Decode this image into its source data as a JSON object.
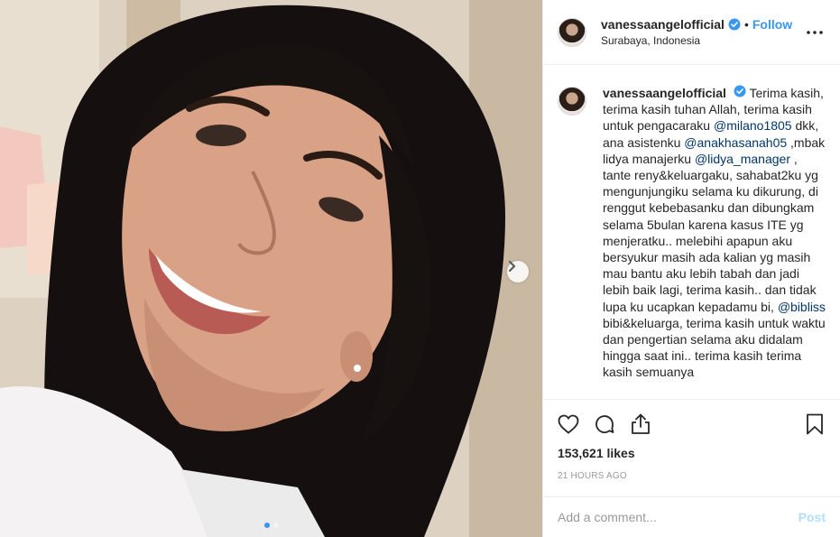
{
  "post": {
    "photo_alt": "",
    "carousel_count": 2,
    "carousel_active": 0
  },
  "header": {
    "username": "vanessaangelofficial",
    "separator": "•",
    "follow_label": "Follow",
    "location": "Surabaya, Indonesia",
    "more_icon": "more-horizontal-icon"
  },
  "caption": {
    "username": "vanessaangelofficial",
    "parts": [
      {
        "type": "text",
        "text": " Terima kasih, terima kasih tuhan Allah, terima kasih untuk pengacaraku "
      },
      {
        "type": "mention",
        "text": "@milano1805"
      },
      {
        "type": "text",
        "text": " dkk, ana asistenku "
      },
      {
        "type": "mention",
        "text": "@anakhasanah05"
      },
      {
        "type": "text",
        "text": " ,mbak lidya manajerku "
      },
      {
        "type": "mention",
        "text": "@lidya_manager"
      },
      {
        "type": "text",
        "text": " , tante reny&keluargaku, sahabat2ku yg mengunjungiku selama ku dikurung, di renggut kebebasanku dan dibungkam selama 5bulan karena kasus ITE yg menjeratku.. melebihi apapun aku bersyukur masih ada kalian yg masih mau bantu aku lebih tabah dan jadi lebih baik lagi, terima kasih.. dan tidak lupa ku ucapkan kepadamu bi, "
      },
      {
        "type": "mention",
        "text": "@bibliss"
      },
      {
        "type": "text",
        "text": " bibi&keluarga, terima kasih untuk waktu dan pengertian selama aku didalam hingga saat ini.. terima kasih terima kasih semuanya"
      }
    ]
  },
  "actions": {
    "like_icon": "heart-icon",
    "comment_icon": "comment-icon",
    "share_icon": "share-icon",
    "save_icon": "bookmark-icon"
  },
  "likes_text": "153,621 likes",
  "timestamp": "21 HOURS AGO",
  "comment": {
    "placeholder": "Add a comment...",
    "post_label": "Post"
  },
  "colors": {
    "accent": "#3897f0",
    "mention": "#003569",
    "muted": "#999999",
    "post_disabled": "#b2dffc",
    "border": "#efefef"
  }
}
